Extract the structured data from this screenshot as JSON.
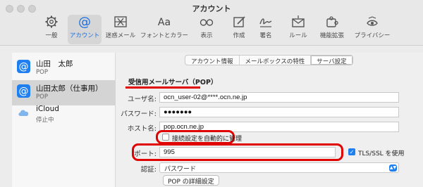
{
  "window": {
    "title": "アカウント"
  },
  "toolbar": {
    "items": [
      {
        "label": "一般",
        "icon": "gear-icon"
      },
      {
        "label": "アカウント",
        "icon": "at-sign-icon",
        "active": true
      },
      {
        "label": "迷惑メール",
        "icon": "junk-mail-icon"
      },
      {
        "label": "フォントとカラー",
        "icon": "font-icon",
        "glyph": "Aa"
      },
      {
        "label": "表示",
        "icon": "glasses-icon"
      },
      {
        "label": "作成",
        "icon": "compose-icon"
      },
      {
        "label": "署名",
        "icon": "signature-icon"
      },
      {
        "label": "ルール",
        "icon": "rules-icon"
      },
      {
        "label": "機能拡張",
        "icon": "extensions-icon"
      },
      {
        "label": "プライバシー",
        "icon": "privacy-icon"
      }
    ]
  },
  "sidebar": {
    "accounts": [
      {
        "name": "山田　太郎",
        "sub": "POP",
        "icon": "at-sign-icon"
      },
      {
        "name": "山田太郎（仕事用）",
        "sub": "POP",
        "icon": "at-sign-icon",
        "selected": true
      },
      {
        "name": "iCloud",
        "sub": "停止中",
        "icon": "cloud-icon"
      }
    ]
  },
  "tabs": [
    "アカウント情報",
    "メールボックスの特性",
    "サーバ設定"
  ],
  "server": {
    "section_title": "受信用メールサーバ（POP）",
    "username_label": "ユーザ名:",
    "username_value": "ocn_user-02@****.ocn.ne.jp",
    "password_label": "パスワード:",
    "password_value": "●●●●●●●",
    "host_label": "ホスト名:",
    "host_value": "pop.ocn.ne.jp",
    "auto_manage_label": "接続設定を自動的に管理",
    "port_label": "ポート:",
    "port_value": "995",
    "tls_label": "TLS/SSL を使用",
    "auth_label": "認証:",
    "auth_value": "パスワード",
    "pop_details_button": "POP の詳細設定"
  },
  "colors": {
    "accent": "#1f7ff0",
    "highlight": "#e00000"
  }
}
